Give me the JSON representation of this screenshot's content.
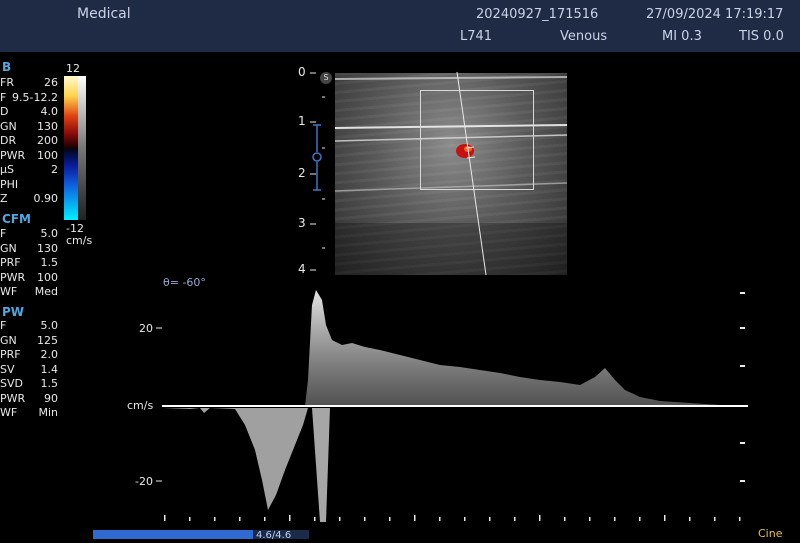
{
  "header": {
    "facility": "Medical",
    "study_id": "20240927_171516",
    "datetime": "27/09/2024 17:19:17",
    "probe": "L741",
    "preset": "Venous",
    "mi": "MI 0.3",
    "tis": "TIS 0.0"
  },
  "b_mode": {
    "title": "B",
    "params": [
      {
        "key": "FR",
        "value": "26"
      },
      {
        "key": "F",
        "value": "9.5-12.2"
      },
      {
        "key": "D",
        "value": "4.0"
      },
      {
        "key": "GN",
        "value": "130"
      },
      {
        "key": "DR",
        "value": "200"
      },
      {
        "key": "PWR",
        "value": "100"
      },
      {
        "key": "µS",
        "value": "2"
      },
      {
        "key": "PHI",
        "value": ""
      },
      {
        "key": "Z",
        "value": "0.90"
      }
    ]
  },
  "cfm": {
    "title": "CFM",
    "params": [
      {
        "key": "F",
        "value": "5.0"
      },
      {
        "key": "GN",
        "value": "130"
      },
      {
        "key": "PRF",
        "value": "1.5"
      },
      {
        "key": "PWR",
        "value": "100"
      },
      {
        "key": "WF",
        "value": "Med"
      }
    ]
  },
  "pw": {
    "title": "PW",
    "params": [
      {
        "key": "F",
        "value": "5.0"
      },
      {
        "key": "GN",
        "value": "125"
      },
      {
        "key": "PRF",
        "value": "2.0"
      },
      {
        "key": "SV",
        "value": "1.4"
      },
      {
        "key": "SVD",
        "value": "1.5"
      },
      {
        "key": "PWR",
        "value": "90"
      },
      {
        "key": "WF",
        "value": "Min"
      }
    ]
  },
  "color_scale": {
    "max": "12",
    "min": "-12",
    "unit": "cm/s"
  },
  "depth_scale": [
    "0",
    "1",
    "2",
    "3",
    "4"
  ],
  "angle": "θ= -60°",
  "spectrum": {
    "unit": "cm/s",
    "ticks": [
      "20",
      "-20"
    ]
  },
  "cine": {
    "progress_label": "4.6/4.6",
    "mode": "Cine",
    "progress": 1.0
  }
}
